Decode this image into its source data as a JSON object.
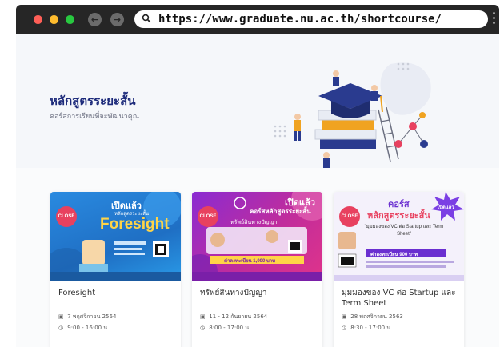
{
  "browser": {
    "url": "https://www.graduate.nu.ac.th/shortcourse/"
  },
  "hero": {
    "title": "หลักสูตรระยะสั้น",
    "subtitle": "คอร์สการเรียนที่จะพัฒนาคุณ"
  },
  "courses": [
    {
      "badge": "CLOSE",
      "poster_heading": "เปิดแล้ว",
      "poster_subheading": "หลักสูตรระยะสั้น",
      "poster_word": "Foresight",
      "title": "Foresight",
      "date": "7 พฤศจิกายน 2564",
      "time": "9:00 - 16:00 น."
    },
    {
      "badge": "CLOSE",
      "poster_heading": "เปิดแล้ว",
      "poster_subheading": "คอร์สหลักสูตรระยะสั้น",
      "poster_word": "ทรัพย์สินทางปัญญา",
      "poster_price": "ค่าลงทะเบียน 1,000 บาท",
      "title": "ทรัพย์สินทางปัญญา",
      "date": "11 - 12 กันยายน 2564",
      "time": "8:00 - 17:00 น."
    },
    {
      "badge": "CLOSE",
      "poster_heading": "คอร์ส",
      "poster_subheading": "หลักสูตรระยะสั้น",
      "poster_burst": "เปิดแล้ว",
      "poster_word": "\"มุมมองของ VC ต่อ Startup และ Term Sheet\"",
      "poster_price": "ค่าลงทะเบียน 900 บาท",
      "title": "มุมมองของ VC ต่อ Startup และ Term Sheet",
      "date": "28 พฤศจิกายน 2563",
      "time": "8:30 - 17:00 น."
    }
  ],
  "colors": {
    "accent": "#1c2a7a",
    "close_badge": "#e8415f",
    "chrome": "#262626"
  }
}
